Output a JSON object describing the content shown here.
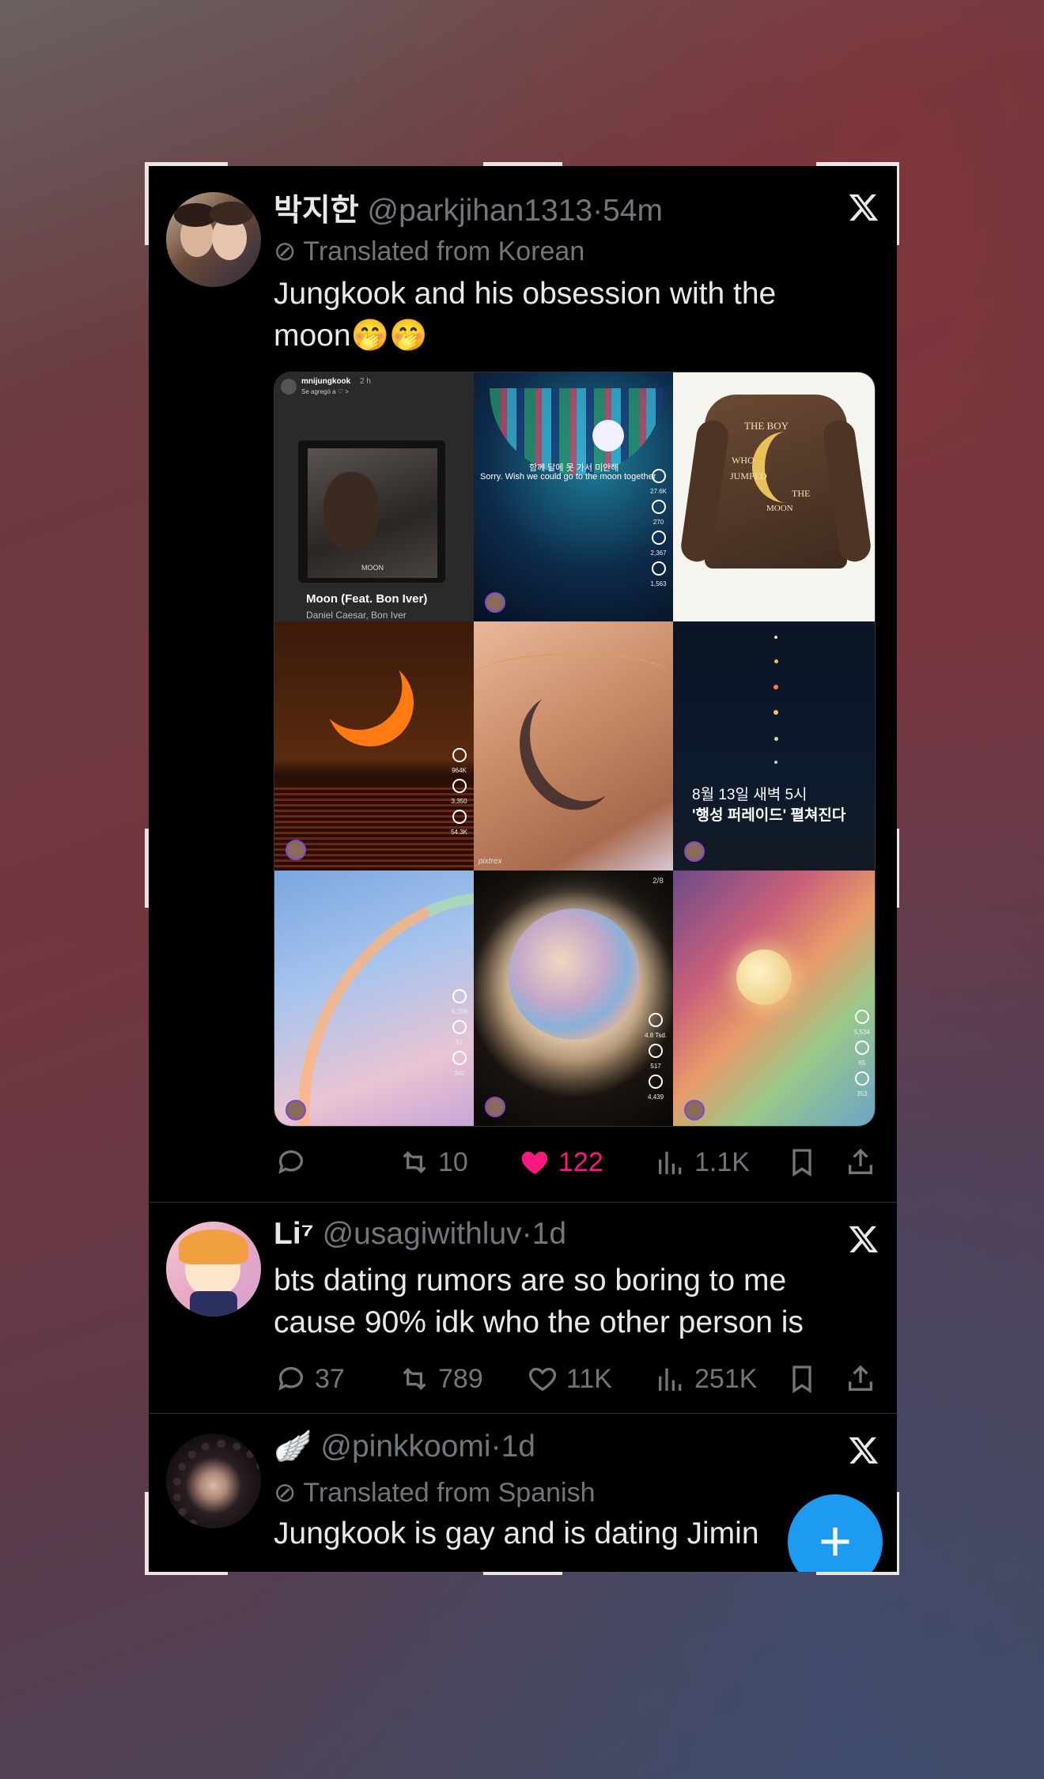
{
  "tweets": [
    {
      "name": "박지한",
      "handle": "@parkjihan1313",
      "time": "54m",
      "translated": "Translated from Korean",
      "text": "Jungkook and his obsession with the moon🤭🤭",
      "media": [
        {
          "song_title": "Moon (Feat. Bon Iver)",
          "song_artist": "Daniel Caesar, Bon Iver",
          "album_label": "MOON",
          "account": "mnijungkook",
          "account_time": "2 h",
          "sub": "Se agregó a ♡ >"
        },
        {
          "caption_ko": "함께 달에 못 가서 미안해",
          "caption_en": "Sorry. Wish we could go to the moon together",
          "stats": [
            "27.6K",
            "270",
            "2,367",
            "1,563"
          ]
        },
        {
          "jacket_text": [
            "THE BOY",
            "WHO",
            "JUMPED",
            "THE",
            "MOON"
          ]
        },
        {
          "stats": [
            "964K",
            "3,350",
            "54.3K"
          ]
        },
        {
          "watermark": "pixtrex"
        },
        {
          "line1": "8월 13일 새벽 5시",
          "line2": "'행성 퍼레이드' 펼쳐진다"
        },
        {
          "stats": [
            "5,256",
            "61",
            "342"
          ]
        },
        {
          "counter": "2/8",
          "stats": [
            "4.8 Tsd.",
            "517",
            "4,439"
          ]
        },
        {
          "stats": [
            "5,534",
            "65",
            "353"
          ]
        }
      ],
      "actions": {
        "reply": "",
        "retweet": "10",
        "like": "122",
        "views": "1.1K"
      }
    },
    {
      "name": "Li⁷",
      "handle": "@usagiwithluv",
      "time": "1d",
      "text": "bts dating rumors are so boring to me cause 90% idk who the other person is",
      "actions": {
        "reply": "37",
        "retweet": "789",
        "like": "11K",
        "views": "251K"
      }
    },
    {
      "name": "🪽",
      "handle": "@pinkkoomi",
      "time": "1d",
      "translated": "Translated from Spanish",
      "text": "Jungkook is gay and is dating Jimin"
    }
  ],
  "fab": {
    "label": "+"
  },
  "colors": {
    "like_active": "#f91880",
    "accent": "#1d9bf0",
    "muted": "#71767b",
    "text": "#e7e9ea"
  }
}
